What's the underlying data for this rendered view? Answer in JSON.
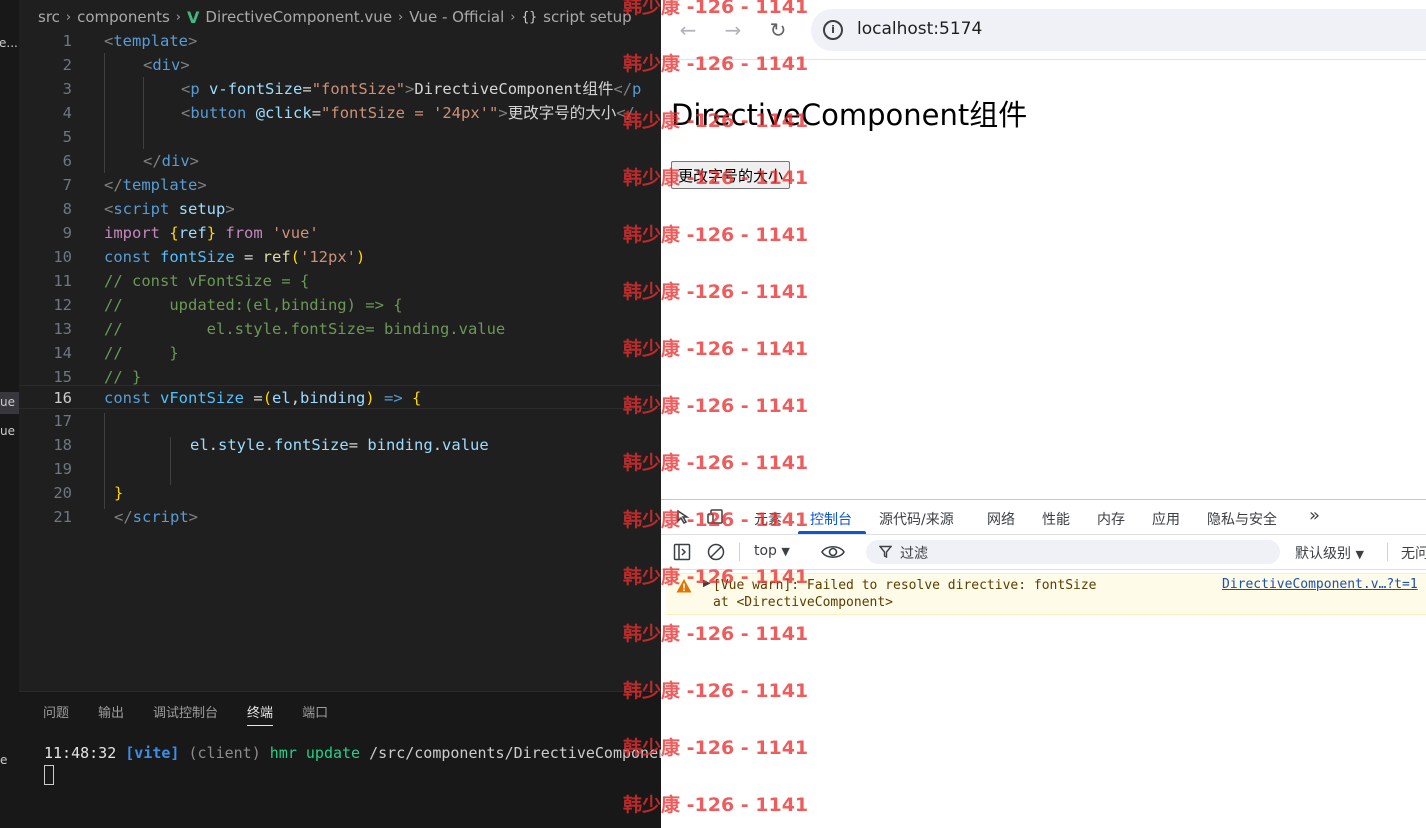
{
  "activity": {
    "stub1": "e...",
    "stub2": "ue",
    "stub3": "ue",
    "stub4": "e"
  },
  "breadcrumb": [
    "src",
    "components",
    "DirectiveComponent.vue",
    "Vue - Official",
    "script setup"
  ],
  "editor": {
    "line_numbers": [
      "1",
      "2",
      "3",
      "4",
      "5",
      "6",
      "7",
      "8",
      "9",
      "10",
      "11",
      "12",
      "13",
      "14",
      "15",
      "16",
      "17",
      "18",
      "19",
      "20",
      "21"
    ],
    "current_line": "16"
  },
  "code": {
    "l1": [
      "<",
      "template",
      ">"
    ],
    "l2": [
      "<",
      "div",
      ">"
    ],
    "l3": [
      "<",
      "p",
      " ",
      "v-fontSize",
      "=",
      "\"fontSize\"",
      ">",
      "DirectiveComponent组件",
      "</",
      "p"
    ],
    "l4": [
      "<",
      "button",
      " ",
      "@click",
      "=",
      "\"fontSize = ",
      "'24px'",
      "\"",
      ">",
      "更改字号的大小",
      "</"
    ],
    "l6": [
      "</",
      "div",
      ">"
    ],
    "l7": [
      "</",
      "template",
      ">"
    ],
    "l8": [
      "<",
      "script",
      " ",
      "setup",
      ">"
    ],
    "l9": [
      "import",
      " ",
      "{",
      "ref",
      "}",
      " ",
      "from",
      " ",
      "'vue'"
    ],
    "l10": [
      "const",
      " ",
      "fontSize",
      " = ",
      "ref",
      "(",
      "'12px'",
      ")"
    ],
    "l11": "// const vFontSize = {",
    "l12": "//     updated:(el,binding) => {",
    "l13": "//         el.style.fontSize= binding.value",
    "l14": "//     }",
    "l15": "// }",
    "l16": [
      "const",
      " ",
      "vFontSize",
      " =",
      "(",
      "el",
      ",",
      "binding",
      ")",
      " => ",
      "{"
    ],
    "l18": [
      "el",
      ".",
      "style",
      ".",
      "fontSize",
      "= ",
      "binding",
      ".",
      "value"
    ],
    "l20": "}",
    "l21": [
      "</",
      "script",
      ">"
    ]
  },
  "panel": {
    "tabs": [
      "问题",
      "输出",
      "调试控制台",
      "终端",
      "端口"
    ],
    "active_tab": "终端",
    "terminal": {
      "time": "11:48:32",
      "vite": "[vite]",
      "client": "(client)",
      "hmr": "hmr update",
      "path": "/src/components/DirectiveComponent.vue"
    }
  },
  "browser": {
    "url": "localhost:5174",
    "heading": "DirectiveComponent组件",
    "button_label": "更改字号的大小"
  },
  "devtools": {
    "tabs": [
      "元素",
      "控制台",
      "源代码/来源",
      "网络",
      "性能",
      "内存",
      "应用",
      "隐私与安全"
    ],
    "more": "»",
    "active_tab": "控制台",
    "context": "top",
    "filter_placeholder": "过滤",
    "levels": "默认级别",
    "issues": "无问题",
    "warning": {
      "line1": "[Vue warn]: Failed to resolve directive: fontSize",
      "line2": "at <DirectiveComponent>",
      "source": "DirectiveComponent.v…?t=1"
    }
  },
  "watermark": "韩少康 -126 - 1141",
  "colors": {
    "accent_blue": "#0b57d0",
    "vue_green": "#41b883",
    "warning_bg": "#fefbe8",
    "watermark_red": "#e83030"
  }
}
